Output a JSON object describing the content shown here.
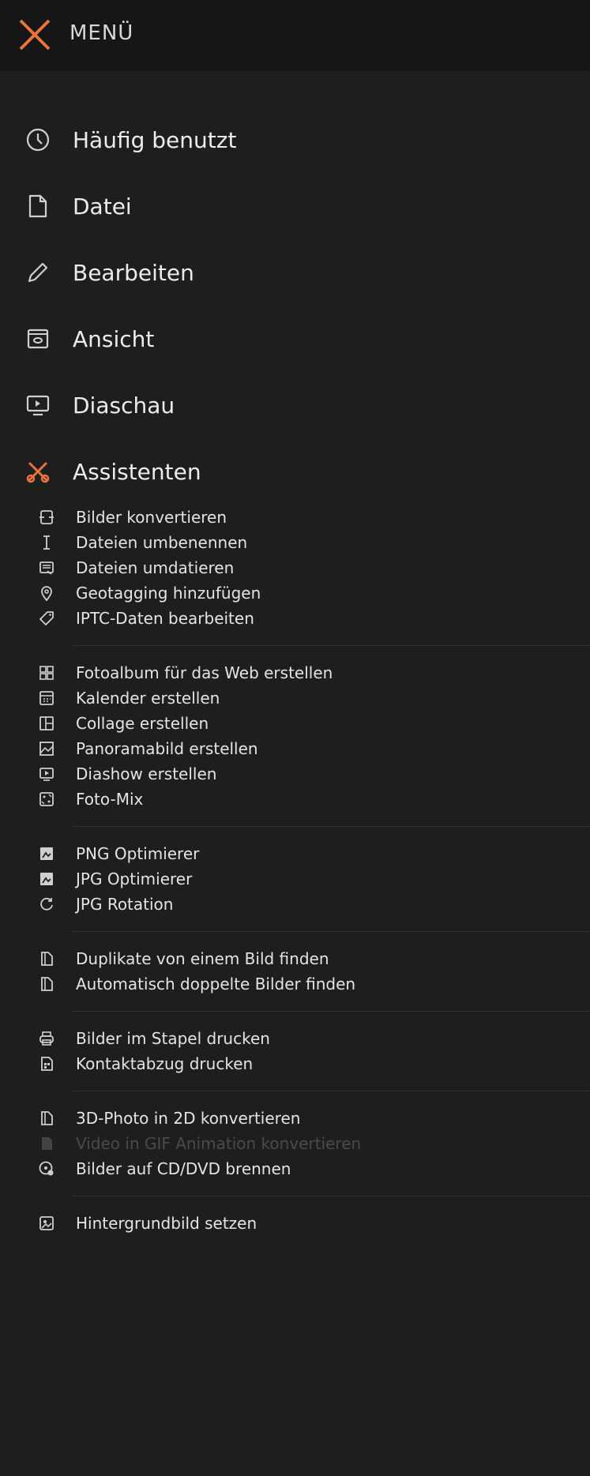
{
  "header": {
    "title": "MENÜ"
  },
  "main_items": [
    {
      "label": "Häufig benutzt",
      "icon": "clock-icon"
    },
    {
      "label": "Datei",
      "icon": "file-icon"
    },
    {
      "label": "Bearbeiten",
      "icon": "pencil-icon"
    },
    {
      "label": "Ansicht",
      "icon": "view-icon"
    },
    {
      "label": "Diaschau",
      "icon": "slideshow-icon"
    },
    {
      "label": "Assistenten",
      "icon": "assistant-icon"
    }
  ],
  "assistant_groups": [
    [
      {
        "label": "Bilder konvertieren",
        "icon": "convert-icon"
      },
      {
        "label": "Dateien umbenennen",
        "icon": "text-cursor-icon"
      },
      {
        "label": "Dateien umdatieren",
        "icon": "redate-icon"
      },
      {
        "label": "Geotagging hinzufügen",
        "icon": "location-pin-icon"
      },
      {
        "label": "IPTC-Daten bearbeiten",
        "icon": "tag-icon"
      }
    ],
    [
      {
        "label": "Fotoalbum für das Web erstellen",
        "icon": "grid-icon"
      },
      {
        "label": "Kalender erstellen",
        "icon": "calendar-icon"
      },
      {
        "label": "Collage erstellen",
        "icon": "collage-icon"
      },
      {
        "label": "Panoramabild erstellen",
        "icon": "panorama-icon"
      },
      {
        "label": "Diashow erstellen",
        "icon": "play-screen-icon"
      },
      {
        "label": "Foto-Mix",
        "icon": "photo-mix-icon"
      }
    ],
    [
      {
        "label": "PNG Optimierer",
        "icon": "image-optimize-icon"
      },
      {
        "label": "JPG Optimierer",
        "icon": "image-optimize-icon"
      },
      {
        "label": "JPG Rotation",
        "icon": "rotate-icon"
      }
    ],
    [
      {
        "label": "Duplikate von einem Bild finden",
        "icon": "duplicate-icon"
      },
      {
        "label": "Automatisch doppelte Bilder finden",
        "icon": "duplicate-icon"
      }
    ],
    [
      {
        "label": "Bilder im Stapel drucken",
        "icon": "printer-icon"
      },
      {
        "label": "Kontaktabzug drucken",
        "icon": "contact-sheet-icon"
      }
    ],
    [
      {
        "label": "3D-Photo in 2D konvertieren",
        "icon": "duplicate-icon"
      },
      {
        "label": "Video in GIF Animation konvertieren",
        "icon": "video-gif-icon",
        "disabled": true
      },
      {
        "label": "Bilder auf CD/DVD brennen",
        "icon": "disc-icon"
      }
    ],
    [
      {
        "label": "Hintergrundbild setzen",
        "icon": "wallpaper-icon"
      }
    ]
  ],
  "colors": {
    "accent": "#e8743b",
    "background": "#1e1e1e",
    "header_bg": "#161616"
  }
}
